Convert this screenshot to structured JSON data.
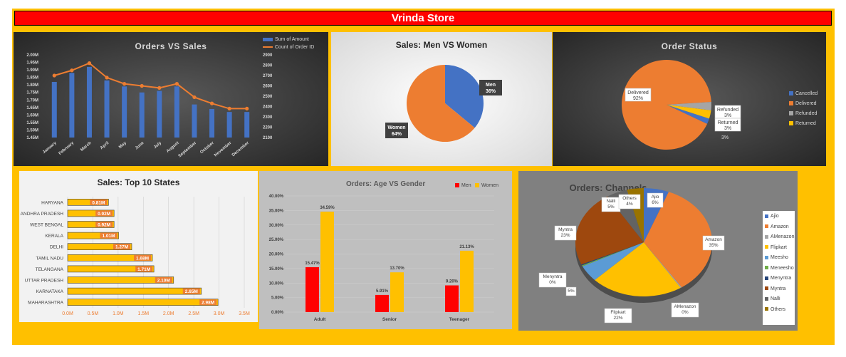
{
  "dashboard": {
    "title": "Vrinda Store"
  },
  "colors": {
    "banner": "#FF0000",
    "background": "#FFC000"
  },
  "charts": [
    {
      "id": "orders-vs-sales",
      "type": "bar",
      "title": "Orders VS Sales",
      "categories": [
        "January",
        "February",
        "March",
        "April",
        "May",
        "June",
        "July",
        "August",
        "September",
        "October",
        "November",
        "December"
      ],
      "series": [
        {
          "name": "Sum of Amount",
          "type": "bar",
          "axis": "left",
          "color": "#4472C4",
          "values": [
            1.82,
            1.88,
            1.92,
            1.83,
            1.79,
            1.75,
            1.76,
            1.79,
            1.67,
            1.64,
            1.62,
            1.62
          ]
        },
        {
          "name": "Count of Order ID",
          "type": "line",
          "axis": "right",
          "color": "#ED7D31",
          "values": [
            2700,
            2750,
            2820,
            2680,
            2620,
            2600,
            2580,
            2620,
            2490,
            2430,
            2380,
            2380
          ]
        }
      ],
      "y_left": {
        "min": 1.45,
        "max": 2.0,
        "ticks": [
          "1.45M",
          "1.50M",
          "1.55M",
          "1.60M",
          "1.65M",
          "1.70M",
          "1.75M",
          "1.80M",
          "1.85M",
          "1.90M",
          "1.95M",
          "2.00M"
        ]
      },
      "y_right": {
        "min": 2100,
        "max": 2900,
        "ticks": [
          "2100",
          "2200",
          "2300",
          "2400",
          "2500",
          "2600",
          "2700",
          "2800",
          "2900"
        ]
      },
      "legend": "top-right"
    },
    {
      "id": "sales-men-women",
      "type": "pie",
      "title": "Sales: Men VS Women",
      "slices": [
        {
          "name": "Men",
          "label": "36%",
          "value": 36,
          "color": "#4472C4"
        },
        {
          "name": "Women",
          "label": "64%",
          "value": 64,
          "color": "#ED7D31"
        }
      ]
    },
    {
      "id": "order-status",
      "type": "pie",
      "title": "Order Status",
      "slices": [
        {
          "name": "Cancelled",
          "value": 2,
          "color": "#4472C4",
          "label": ""
        },
        {
          "name": "Delivered",
          "value": 92,
          "color": "#ED7D31",
          "label": "92%"
        },
        {
          "name": "Refunded",
          "value": 3,
          "color": "#A5A5A5",
          "label": "3%"
        },
        {
          "name": "Returned",
          "value": 3,
          "color": "#FFC000",
          "label": "3%"
        }
      ],
      "legend": "right"
    },
    {
      "id": "top-10-states",
      "type": "bar",
      "orientation": "horizontal",
      "title": "Sales: Top 10 States",
      "categories": [
        "HARYANA",
        "ANDHRA PRADESH",
        "WEST BENGAL",
        "KERALA",
        "DELHI",
        "TAMIL NADU",
        "TELANGANA",
        "UTTAR PRADESH",
        "KARNATAKA",
        "MAHARASHTRA"
      ],
      "values": [
        0.81,
        0.92,
        0.92,
        1.01,
        1.27,
        1.68,
        1.71,
        2.1,
        2.65,
        2.98
      ],
      "labels": [
        "0.81M",
        "0.92M",
        "0.92M",
        "1.01M",
        "1.27M",
        "1.68M",
        "1.71M",
        "2.10M",
        "2.65M",
        "2.98M"
      ],
      "x_ticks": [
        "0.0M",
        "0.5M",
        "1.0M",
        "1.5M",
        "2.0M",
        "2.5M",
        "3.0M",
        "3.5M"
      ],
      "xlim": [
        0,
        3.5
      ],
      "color": "#FFC000"
    },
    {
      "id": "age-vs-gender",
      "type": "bar",
      "title": "Orders: Age VS Gender",
      "categories": [
        "Adult",
        "Senior",
        "Teenager"
      ],
      "series": [
        {
          "name": "Men",
          "color": "#FF0000",
          "values": [
            15.47,
            5.91,
            9.2
          ],
          "labels": [
            "15.47%",
            "5.91%",
            "9.20%"
          ]
        },
        {
          "name": "Women",
          "color": "#FFC000",
          "values": [
            34.59,
            13.7,
            21.13
          ],
          "labels": [
            "34.59%",
            "13.70%",
            "21.13%"
          ]
        }
      ],
      "ylim": [
        0,
        40
      ],
      "y_ticks": [
        "0.00%",
        "5.00%",
        "10.00%",
        "15.00%",
        "20.00%",
        "25.00%",
        "30.00%",
        "35.00%",
        "40.00%"
      ],
      "legend": "top-right"
    },
    {
      "id": "channels",
      "type": "pie",
      "title": "Orders: Channels",
      "slices": [
        {
          "name": "Ajio",
          "value": 6,
          "color": "#4472C4",
          "label": "Ajio\n6%"
        },
        {
          "name": "Amazon",
          "value": 35,
          "color": "#ED7D31",
          "label": "Amazon\n35%"
        },
        {
          "name": "AMenazon",
          "value": 0.3,
          "color": "#A5A5A5",
          "label": "AMenazon\n0%"
        },
        {
          "name": "Flipkart",
          "value": 22,
          "color": "#FFC000",
          "label": "Flipkart\n22%"
        },
        {
          "name": "Meesho",
          "value": 5,
          "color": "#5B9BD5",
          "label": "5%"
        },
        {
          "name": "Meneesho",
          "value": 0.3,
          "color": "#70AD47",
          "label": ""
        },
        {
          "name": "Menyntra",
          "value": 0.3,
          "color": "#264478",
          "label": "Menyntra\n0%"
        },
        {
          "name": "Myntra",
          "value": 23,
          "color": "#9E480E",
          "label": "Myntra\n23%"
        },
        {
          "name": "Nalli",
          "value": 5,
          "color": "#636363",
          "label": "Nalli\n5%"
        },
        {
          "name": "Others",
          "value": 4,
          "color": "#997300",
          "label": "Others\n4%"
        }
      ],
      "legend": "right"
    }
  ]
}
